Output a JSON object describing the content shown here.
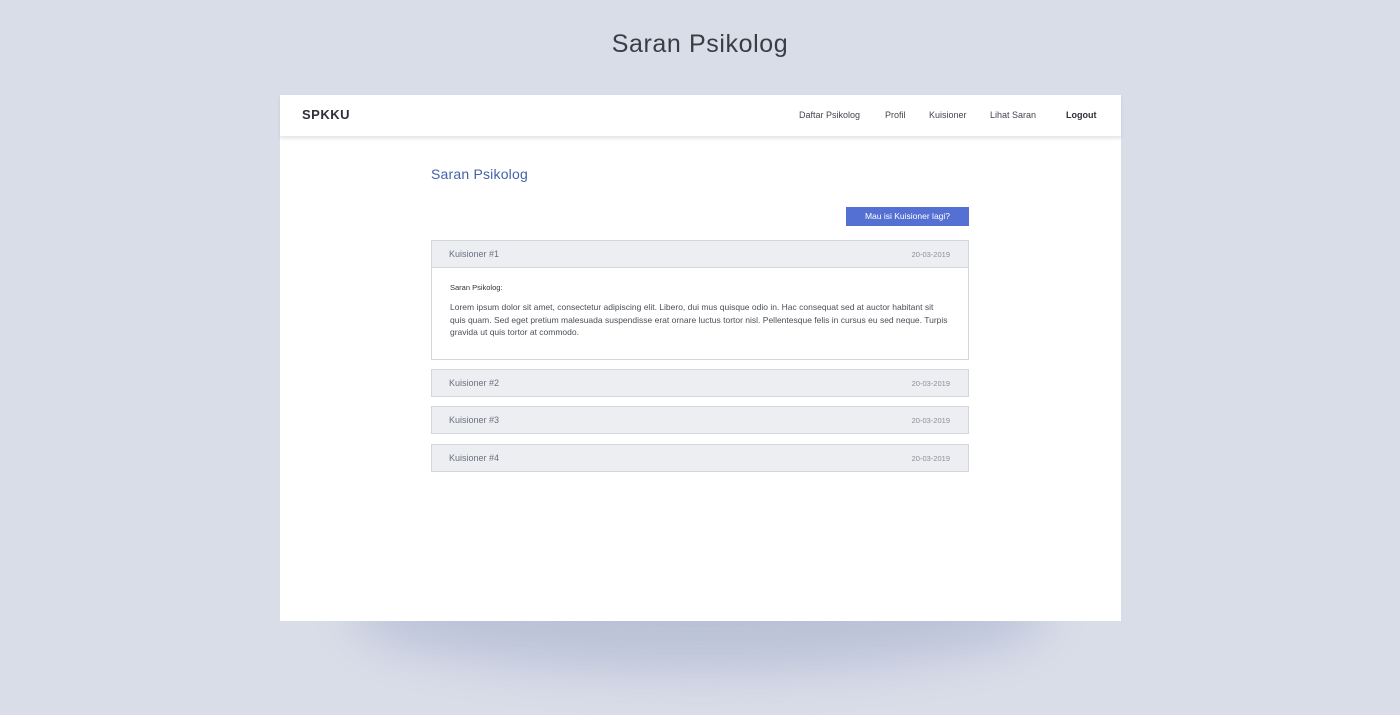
{
  "page": {
    "title": "Saran Psikolog"
  },
  "navbar": {
    "brand": "SPKKU",
    "links": [
      {
        "label": "Daftar Psikolog"
      },
      {
        "label": "Profil"
      },
      {
        "label": "Kuisioner"
      },
      {
        "label": "Lihat Saran"
      },
      {
        "label": "Logout"
      }
    ]
  },
  "main": {
    "title": "Saran Psikolog",
    "cta_label": "Mau isi Kuisioner lagi?",
    "accordion": [
      {
        "label": "Kuisioner #1",
        "date": "20-03-2019",
        "expanded": true,
        "body_label": "Saran Psikolog:",
        "body_text": "Lorem ipsum dolor sit amet, consectetur adipiscing elit. Libero, dui mus quisque odio in. Hac consequat sed at auctor habitant sit quis quam. Sed eget pretium malesuada suspendisse erat ornare luctus tortor nisl. Pellentesque felis in cursus eu sed neque. Turpis gravida ut quis tortor at commodo."
      },
      {
        "label": "Kuisioner #2",
        "date": "20-03-2019",
        "expanded": false
      },
      {
        "label": "Kuisioner #3",
        "date": "20-03-2019",
        "expanded": false
      },
      {
        "label": "Kuisioner #4",
        "date": "20-03-2019",
        "expanded": false
      }
    ]
  },
  "colors": {
    "background": "#d9dde8",
    "accent": "#5470d2",
    "section_title": "#4563a8",
    "accordion_header": "#eceef1"
  }
}
